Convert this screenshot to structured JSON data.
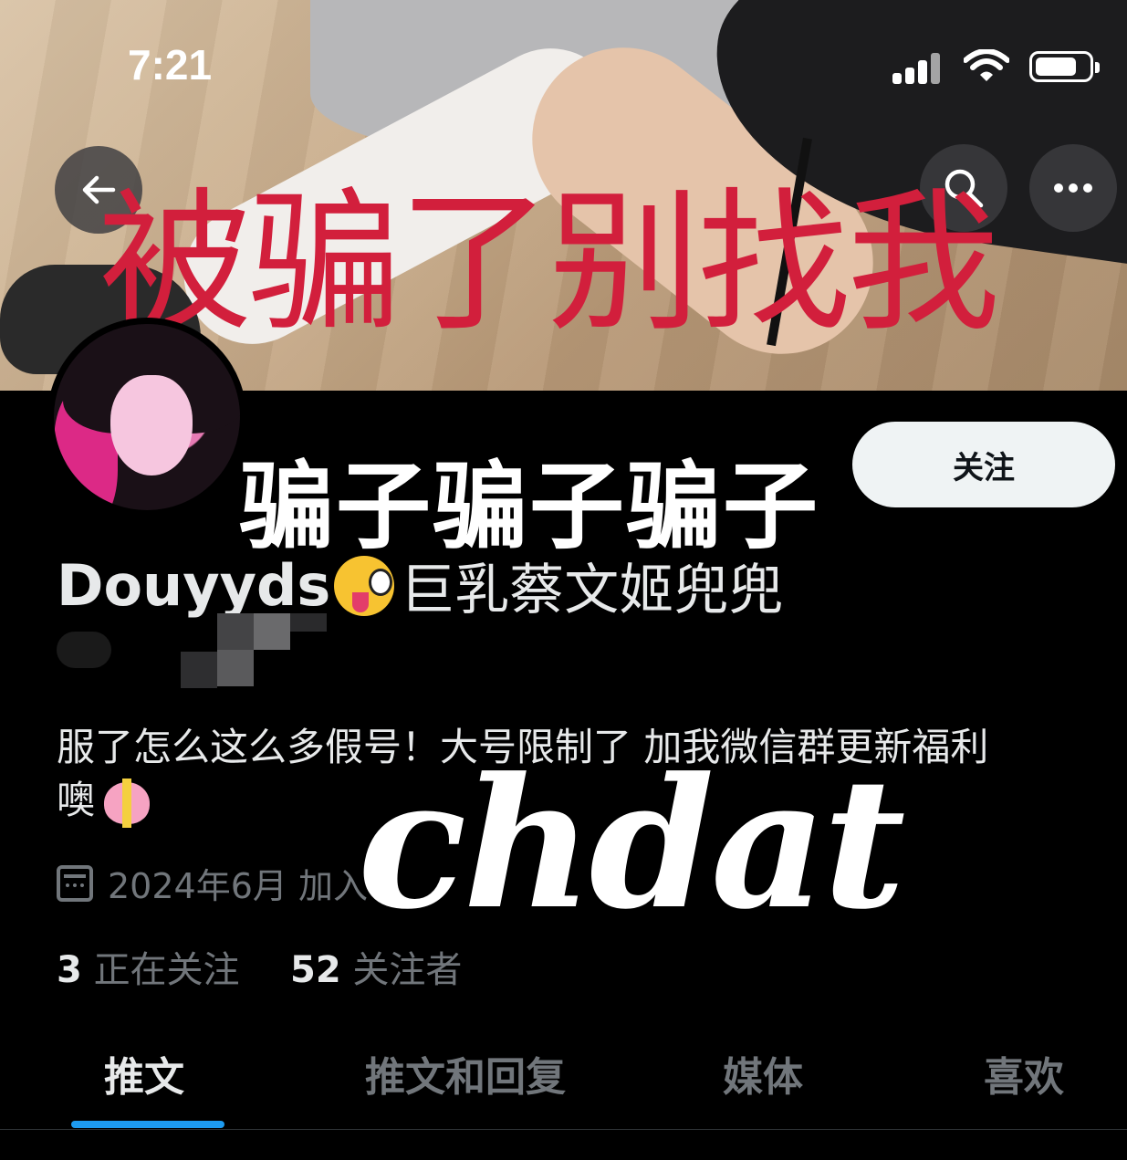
{
  "status_bar": {
    "time": "7:21"
  },
  "banner": {
    "overlay_text": "被骗了别找我"
  },
  "actions": {
    "back_icon": "arrow-left-icon",
    "search_icon": "search-icon",
    "more_icon": "more-horizontal-icon"
  },
  "overlay_scam": "骗子骗子骗子",
  "follow_button": {
    "label": "关注"
  },
  "profile": {
    "name_latin": "Douyyds",
    "name_emoji": "😜",
    "name_cn": "巨乳蔡文姬兜兜",
    "bio_line1": "服了怎么这么多假号！大号限制了 加我微信群更新福利",
    "bio_line2": "噢",
    "bio_emoji": "💝",
    "joined": "2024年6月 加入",
    "following_count": "3",
    "following_label": "正在关注",
    "followers_count": "52",
    "followers_label": "关注者"
  },
  "overlay_watermark": "chdat",
  "tabs": [
    {
      "label": "推文",
      "active": true
    },
    {
      "label": "推文和回复",
      "active": false
    },
    {
      "label": "媒体",
      "active": false
    },
    {
      "label": "喜欢",
      "active": false
    }
  ],
  "colors": {
    "accent": "#1d9bf0",
    "overlay_red": "#d21f3c",
    "background": "#000000",
    "muted_text": "#71767b"
  }
}
